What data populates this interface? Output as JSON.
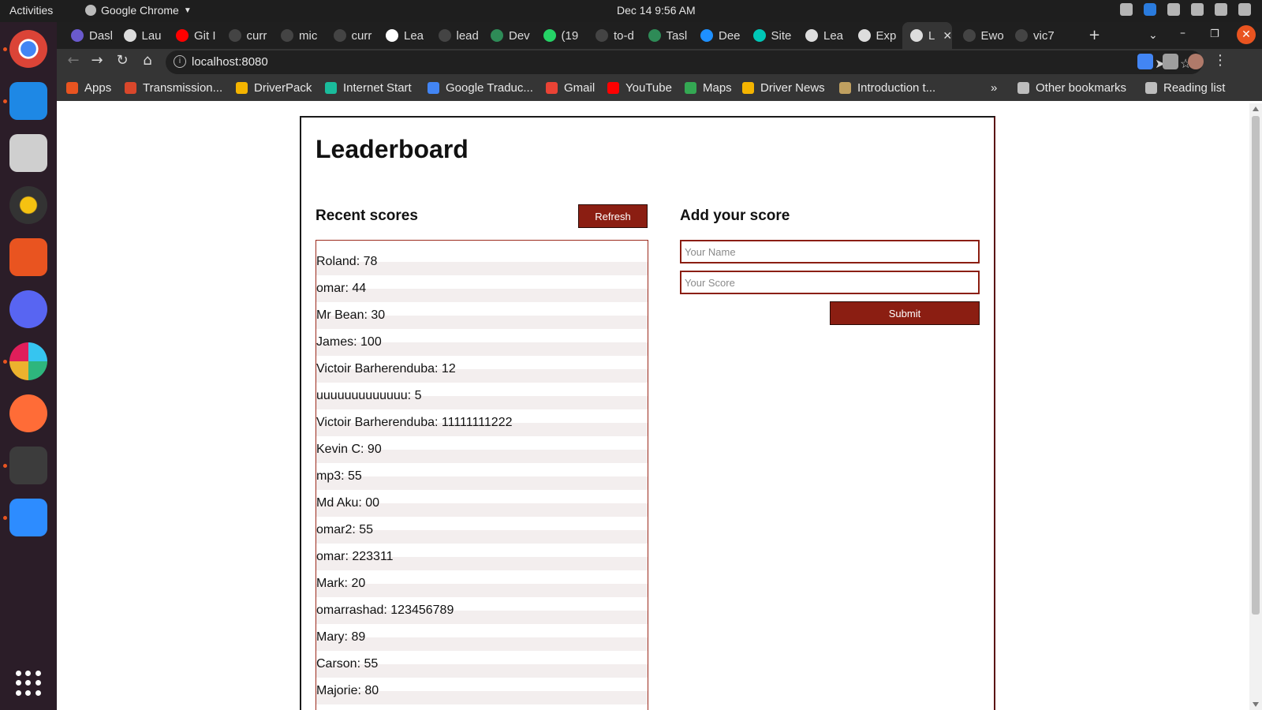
{
  "system": {
    "activities": "Activities",
    "app_name": "Google Chrome",
    "clock": "Dec 14  9:56 AM"
  },
  "tabs": [
    {
      "label": "Dasl",
      "color": "#6a5acd"
    },
    {
      "label": "Lau",
      "color": "#dddddd"
    },
    {
      "label": "Git I",
      "color": "#ff0000"
    },
    {
      "label": "curr",
      "color": "#444444"
    },
    {
      "label": "mic",
      "color": "#444444"
    },
    {
      "label": "curr",
      "color": "#444444"
    },
    {
      "label": "Lea",
      "color": "#ffffff"
    },
    {
      "label": "lead",
      "color": "#444444"
    },
    {
      "label": "Dev",
      "color": "#2e8b57"
    },
    {
      "label": "(19",
      "color": "#25d366"
    },
    {
      "label": "to-d",
      "color": "#444444"
    },
    {
      "label": "Tasl",
      "color": "#2e8b57"
    },
    {
      "label": "Dee",
      "color": "#1e90ff"
    },
    {
      "label": "Site",
      "color": "#00c7b7"
    },
    {
      "label": "Lea",
      "color": "#dddddd"
    },
    {
      "label": "Exp",
      "color": "#dddddd"
    },
    {
      "label": "L",
      "color": "#dddddd",
      "active": true
    },
    {
      "label": "Ewo",
      "color": "#444444"
    },
    {
      "label": "vic7",
      "color": "#444444"
    }
  ],
  "browser": {
    "url": "localhost:8080"
  },
  "bookmarks": [
    {
      "label": "Apps",
      "color": "#e95420"
    },
    {
      "label": "Transmission...",
      "color": "#d9472b"
    },
    {
      "label": "DriverPack",
      "color": "#f4b400"
    },
    {
      "label": "Internet Start",
      "color": "#1abc9c"
    },
    {
      "label": "Google Traduc...",
      "color": "#4285f4"
    },
    {
      "label": "Gmail",
      "color": "#ea4335"
    },
    {
      "label": "YouTube",
      "color": "#ff0000"
    },
    {
      "label": "Maps",
      "color": "#34a853"
    },
    {
      "label": "Driver News",
      "color": "#f4b400"
    },
    {
      "label": "Introduction t...",
      "color": "#c0a060"
    }
  ],
  "bookmarks_right": {
    "overflow": "»",
    "other": "Other bookmarks",
    "reading": "Reading list"
  },
  "page": {
    "title": "Leaderboard",
    "recent_title": "Recent scores",
    "refresh_label": "Refresh",
    "add_title": "Add your score",
    "name_placeholder": "Your Name",
    "score_placeholder": "Your Score",
    "submit_label": "Submit",
    "scores": [
      "Roland: 78",
      "omar: 44",
      "Mr Bean: 30",
      "James: 100",
      "Victoir Barherenduba: 12",
      "uuuuuuuuuuuuu: 5",
      "Victoir Barherenduba: 11111111222",
      "Kevin C: 90",
      "mp3: 55",
      "Md Aku: 00",
      "omar2: 55",
      "omar: 223311",
      "Mark: 20",
      "omarrashad: 123456789",
      "Mary: 89",
      "Carson: 55",
      "Majorie: 80"
    ],
    "accent_color": "#8b1e12"
  }
}
